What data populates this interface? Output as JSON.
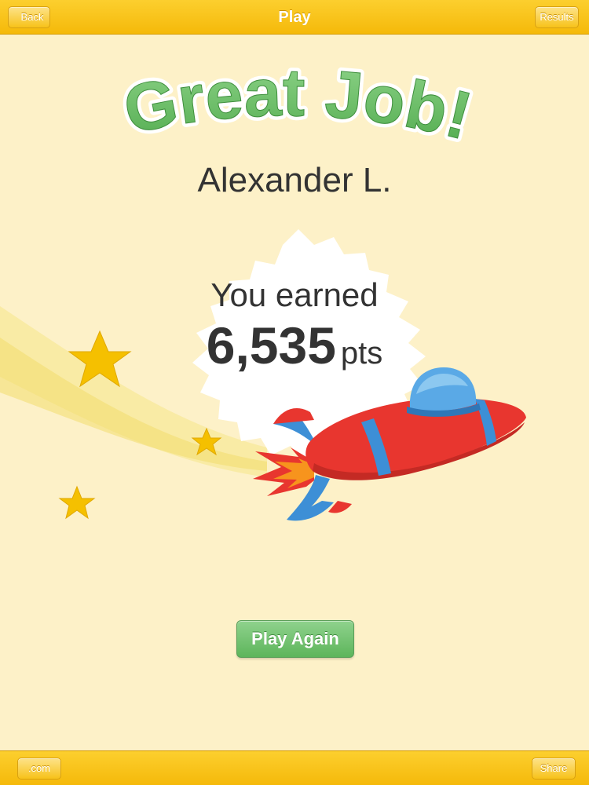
{
  "header": {
    "title": "Play",
    "back_label": "Back",
    "results_label": "Results"
  },
  "headline": "Great Job!",
  "player_name": "Alexander L.",
  "score": {
    "earned_label": "You earned",
    "value": "6,535",
    "unit": "pts"
  },
  "play_again_label": "Play Again",
  "footer": {
    "site_label": ".com",
    "share_label": "Share"
  },
  "colors": {
    "bar": "#f7c21a",
    "background": "#fdf1c8",
    "headline_green": "#5cb85c",
    "rocket_red": "#e8362f",
    "rocket_blue": "#3d8fd6",
    "star_yellow": "#f5c000"
  },
  "icons": [
    "back-chevron-icon",
    "rocket-icon",
    "star-icon",
    "starburst-badge"
  ]
}
